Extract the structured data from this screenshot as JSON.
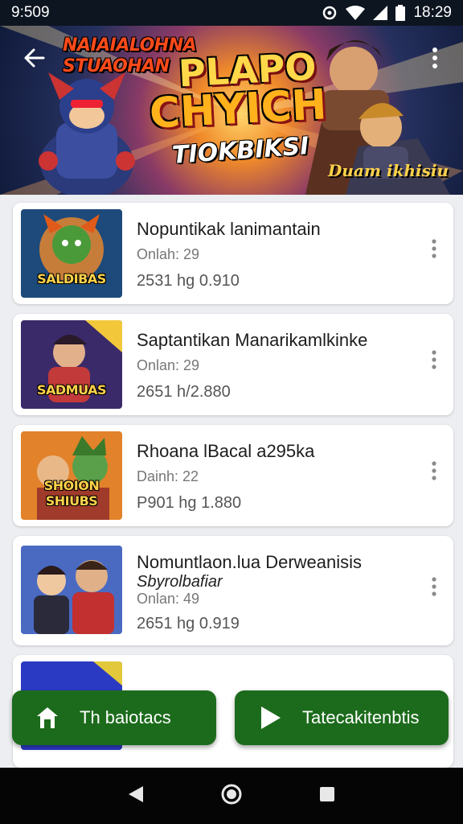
{
  "status_bar": {
    "time_left": "9:509",
    "time_right": "18:29",
    "icons": [
      "cast-icon",
      "wifi-icon",
      "signal-icon",
      "battery-icon"
    ]
  },
  "banner": {
    "small_text": "NAIAIALOHNA\nSTUAOHAN",
    "title_line1": "PLAPO",
    "title_line2": "CHYICH",
    "title_line3": "TIOKBIKSI",
    "tag": "Duam ikhisiu",
    "back_icon": "arrow-back-icon",
    "menu_icon": "more-vert-icon"
  },
  "items": [
    {
      "title": "Nopuntikak lanimantain",
      "subtitle": "",
      "meta1": "Onlah: 29",
      "meta2": "2531 hg 0.910",
      "thumb_label": "SALDIBAS"
    },
    {
      "title": "Saptantikan Manarikamlkinke",
      "subtitle": "",
      "meta1": "Onlan: 29",
      "meta2": "2651 h/2.880",
      "thumb_label": "SADMUAS"
    },
    {
      "title": "Rhoana lBacal a295ka",
      "subtitle": "",
      "meta1": "Dainh: 22",
      "meta2": "P901 hg 1.880",
      "thumb_label": "SHOION SHIUBS"
    },
    {
      "title": "Nomuntlaon.lua Derweanisis",
      "subtitle": "Sbyrolbafiar",
      "meta1": "Onlan: 49",
      "meta2": "2651 hg 0.919",
      "thumb_label": ""
    },
    {
      "title": "",
      "subtitle": "",
      "meta1": "",
      "meta2": "",
      "thumb_label": ""
    }
  ],
  "buttons": {
    "home_label": "Th baiotacs",
    "play_label": "Tatecakitenbtis",
    "home_icon": "home-icon",
    "play_icon": "play-icon"
  },
  "nav": {
    "icons": [
      "nav-back-icon",
      "nav-home-icon",
      "nav-recents-icon"
    ]
  },
  "colors": {
    "accent_green": "#1c6b1c",
    "status_bar": "#0d1520",
    "background": "#eceef1"
  }
}
